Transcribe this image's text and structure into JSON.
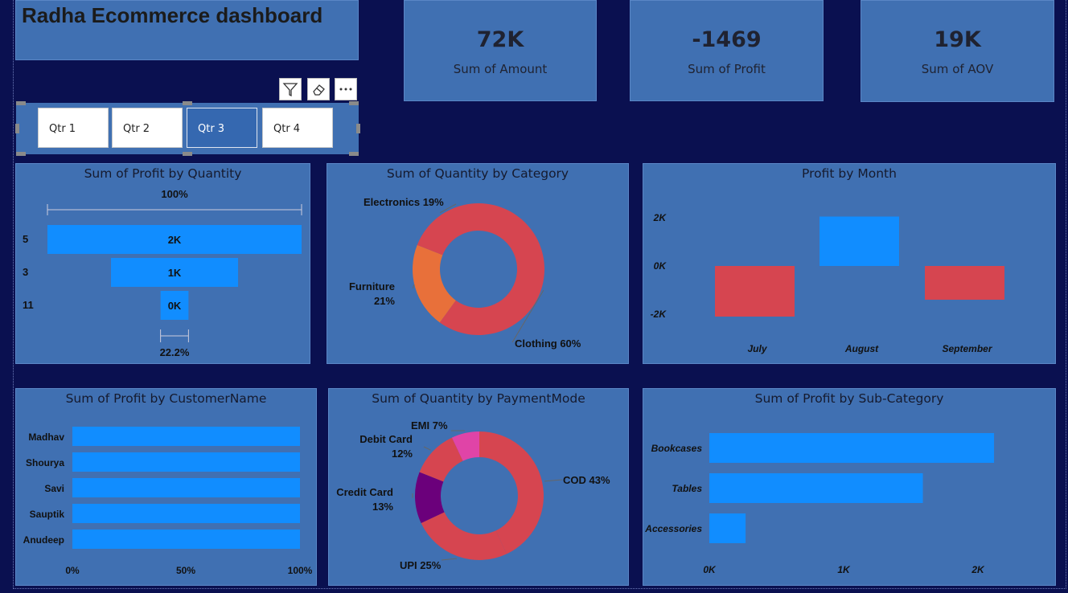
{
  "dashboard_title": "Radha Ecommerce dashboard",
  "kpis": [
    {
      "value": "72K",
      "label": "Sum of Amount"
    },
    {
      "value": "-1469",
      "label": "Sum of Profit"
    },
    {
      "value": "19K",
      "label": "Sum of AOV"
    }
  ],
  "slicer": {
    "items": [
      "Qtr 1",
      "Qtr 2",
      "Qtr 3",
      "Qtr 4"
    ],
    "selected": "Qtr 3",
    "toolbar_icons": [
      "filter-icon",
      "eraser-icon",
      "more-options-icon"
    ]
  },
  "colors": {
    "background": "#0a1050",
    "card": "#4070b2",
    "blue": "#118dff",
    "red": "#d64550",
    "orange": "#e8703a",
    "purple": "#6b007b",
    "pink": "#e044a7"
  },
  "chart_data": [
    {
      "type": "funnel",
      "title": "Sum of Profit by Quantity",
      "categories": [
        "5",
        "3",
        "11"
      ],
      "values": [
        2,
        1,
        0.22
      ],
      "data_labels": [
        "2K",
        "1K",
        "0K"
      ],
      "top_label": "100%",
      "bottom_label": "22.2%"
    },
    {
      "type": "pie",
      "title": "Sum of Quantity by Category",
      "donut": true,
      "slices": [
        {
          "label": "Clothing",
          "value": 60,
          "text": "Clothing 60%",
          "color": "#d64550"
        },
        {
          "label": "Furniture",
          "value": 21,
          "text": "Furniture",
          "text2": "21%",
          "color": "#e8703a"
        },
        {
          "label": "Electronics",
          "value": 19,
          "text": "Electronics 19%",
          "color": "#d64550"
        }
      ]
    },
    {
      "type": "bar",
      "title": "Profit by Month",
      "categories": [
        "July",
        "August",
        "September"
      ],
      "values": [
        -2100,
        2050,
        -1400
      ],
      "ytick_labels": [
        "2K",
        "0K",
        "-2K"
      ],
      "ylim": [
        -2100,
        2100
      ],
      "colors": [
        "#d64550",
        "#118dff",
        "#d64550"
      ]
    },
    {
      "type": "bar",
      "orientation": "horizontal",
      "stacked_100": true,
      "title": "Sum of Profit by CustomerName",
      "categories": [
        "Madhav",
        "Shourya",
        "Savi",
        "Sauptik",
        "Anudeep"
      ],
      "values": [
        100,
        100,
        100,
        100,
        100
      ],
      "xtick_labels": [
        "0%",
        "50%",
        "100%"
      ],
      "xlim": [
        0,
        100
      ]
    },
    {
      "type": "pie",
      "title": "Sum of Quantity by PaymentMode",
      "donut": true,
      "slices": [
        {
          "label": "COD",
          "value": 43,
          "text": "COD 43%",
          "color": "#d64550"
        },
        {
          "label": "UPI",
          "value": 25,
          "text": "UPI 25%",
          "color": "#d64550"
        },
        {
          "label": "Credit Card",
          "value": 13,
          "text": "Credit Card",
          "text2": "13%",
          "color": "#6b007b"
        },
        {
          "label": "Debit Card",
          "value": 12,
          "text": "Debit Card",
          "text2": "12%",
          "color": "#d64550"
        },
        {
          "label": "EMI",
          "value": 7,
          "text": "EMI 7%",
          "color": "#e044a7"
        }
      ]
    },
    {
      "type": "bar",
      "orientation": "horizontal",
      "title": "Sum of Profit by Sub-Category",
      "categories": [
        "Bookcases",
        "Tables",
        "Accessories"
      ],
      "values": [
        2120,
        1590,
        270
      ],
      "xtick_labels": [
        "0K",
        "1K",
        "2K"
      ],
      "xlim": [
        0,
        2400
      ]
    }
  ]
}
